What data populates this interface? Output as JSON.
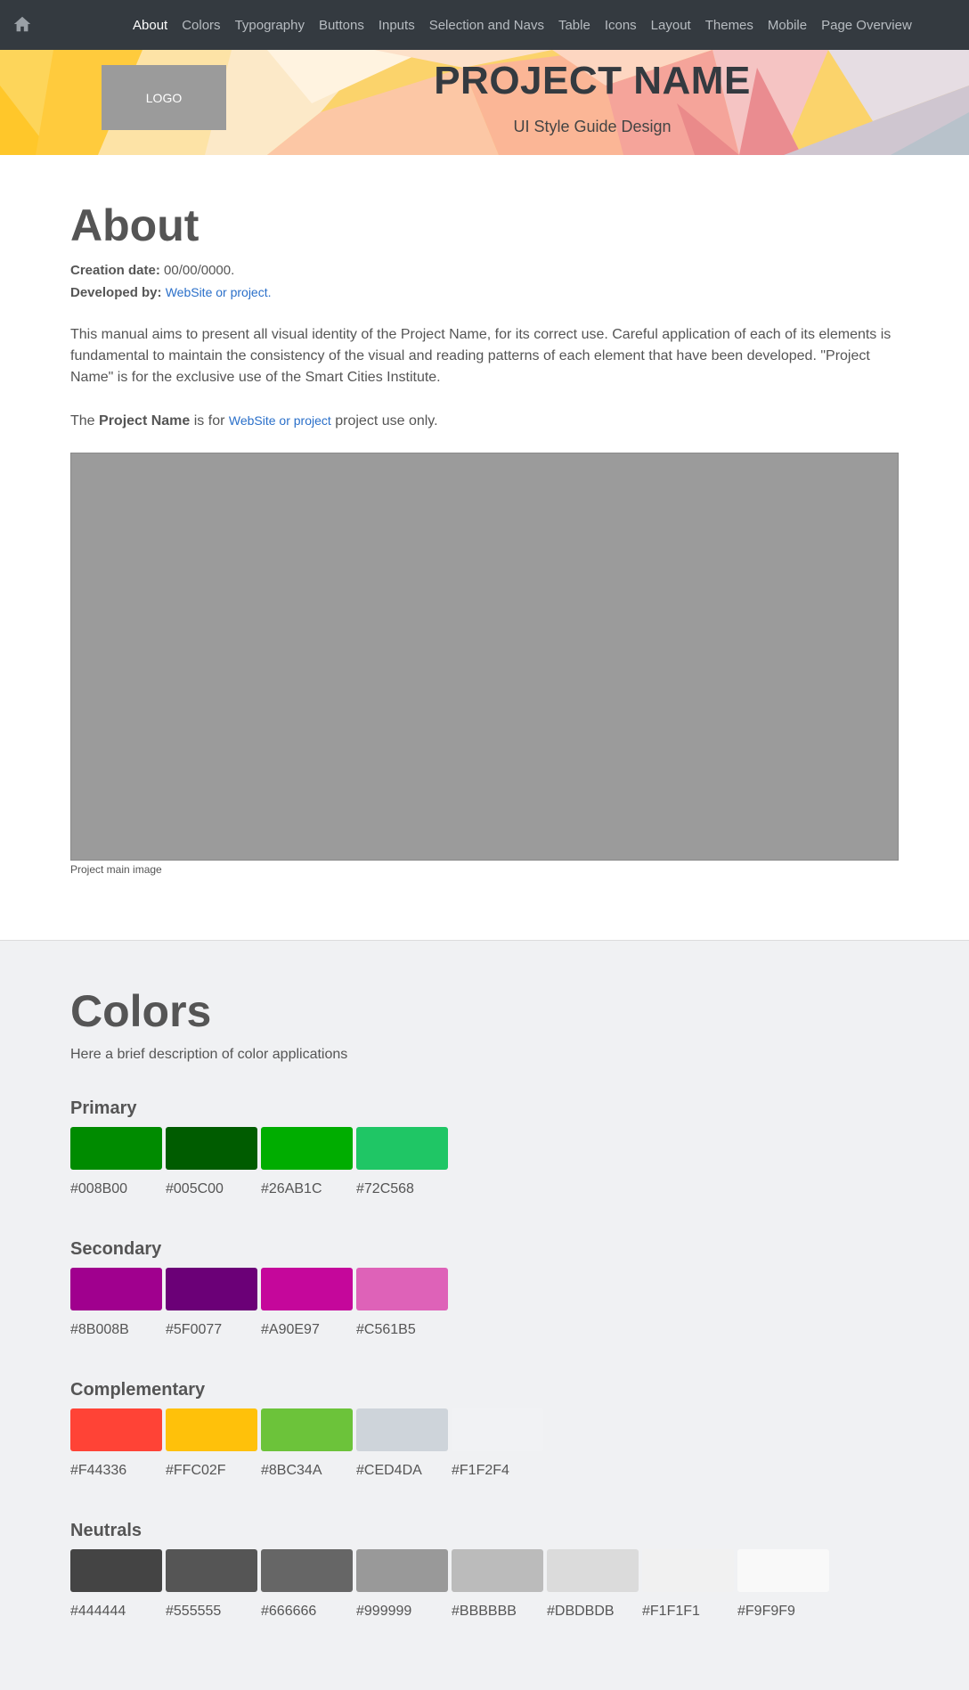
{
  "nav": {
    "home_icon": "home-icon",
    "items": [
      "About",
      "Colors",
      "Typography",
      "Buttons",
      "Inputs",
      "Selection and Navs",
      "Table",
      "Icons",
      "Layout",
      "Themes",
      "Mobile",
      "Page Overview"
    ],
    "active": "About"
  },
  "header": {
    "logo": "LOGO",
    "title": "PROJECT NAME",
    "subtitle": "UI Style Guide Design"
  },
  "about": {
    "heading": "About",
    "creation_label": "Creation date:",
    "creation_value": "00/00/0000.",
    "developed_label": "Developed by:",
    "developed_link": "WebSite or project",
    "developed_suffix": ".",
    "paragraph": "This manual aims to present all visual identity of the Project Name, for its correct use. Careful application of each of its elements is fundamental to maintain the consistency of the visual and reading patterns of each element that have been developed. \"Project Name\" is for the exclusive use of the Smart Cities Institute.",
    "usage_prefix": "The",
    "usage_bold": "Project Name",
    "usage_mid": "is for",
    "usage_link": "WebSite or project",
    "usage_suffix": "project use only.",
    "image_caption": "Project main image"
  },
  "colors": {
    "heading": "Colors",
    "description": "Here a brief description of color applications",
    "groups": [
      {
        "name": "Primary",
        "swatches": [
          {
            "hex": "#008B00",
            "color": "#008B00"
          },
          {
            "hex": "#005C00",
            "color": "#005C00"
          },
          {
            "hex": "#26AB1C",
            "color": "#00AD00"
          },
          {
            "hex": "#72C568",
            "color": "#1FC665"
          }
        ]
      },
      {
        "name": "Secondary",
        "swatches": [
          {
            "hex": "#8B008B",
            "color": "#A0008E"
          },
          {
            "hex": "#5F0077",
            "color": "#6B0077"
          },
          {
            "hex": "#A90E97",
            "color": "#C5079B"
          },
          {
            "hex": "#C561B5",
            "color": "#DE62B8"
          }
        ]
      },
      {
        "name": "Complementary",
        "swatches": [
          {
            "hex": "#F44336",
            "color": "#FF4336"
          },
          {
            "hex": "#FFC02F",
            "color": "#FFC10A"
          },
          {
            "hex": "#8BC34A",
            "color": "#6CC33A"
          },
          {
            "hex": "#CED4DA",
            "color": "#CED4DA"
          },
          {
            "hex": "#F1F2F4",
            "color": "#F1F2F4"
          }
        ]
      },
      {
        "name": "Neutrals",
        "swatches": [
          {
            "hex": "#444444",
            "color": "#444444"
          },
          {
            "hex": "#555555",
            "color": "#555555"
          },
          {
            "hex": "#666666",
            "color": "#666666"
          },
          {
            "hex": "#999999",
            "color": "#999999"
          },
          {
            "hex": "#BBBBBB",
            "color": "#BBBBBB"
          },
          {
            "hex": "#DBDBDB",
            "color": "#DBDBDB"
          },
          {
            "hex": "#F1F1F1",
            "color": "#F1F1F1"
          },
          {
            "hex": "#F9F9F9",
            "color": "#F9F9F9"
          }
        ]
      }
    ]
  }
}
